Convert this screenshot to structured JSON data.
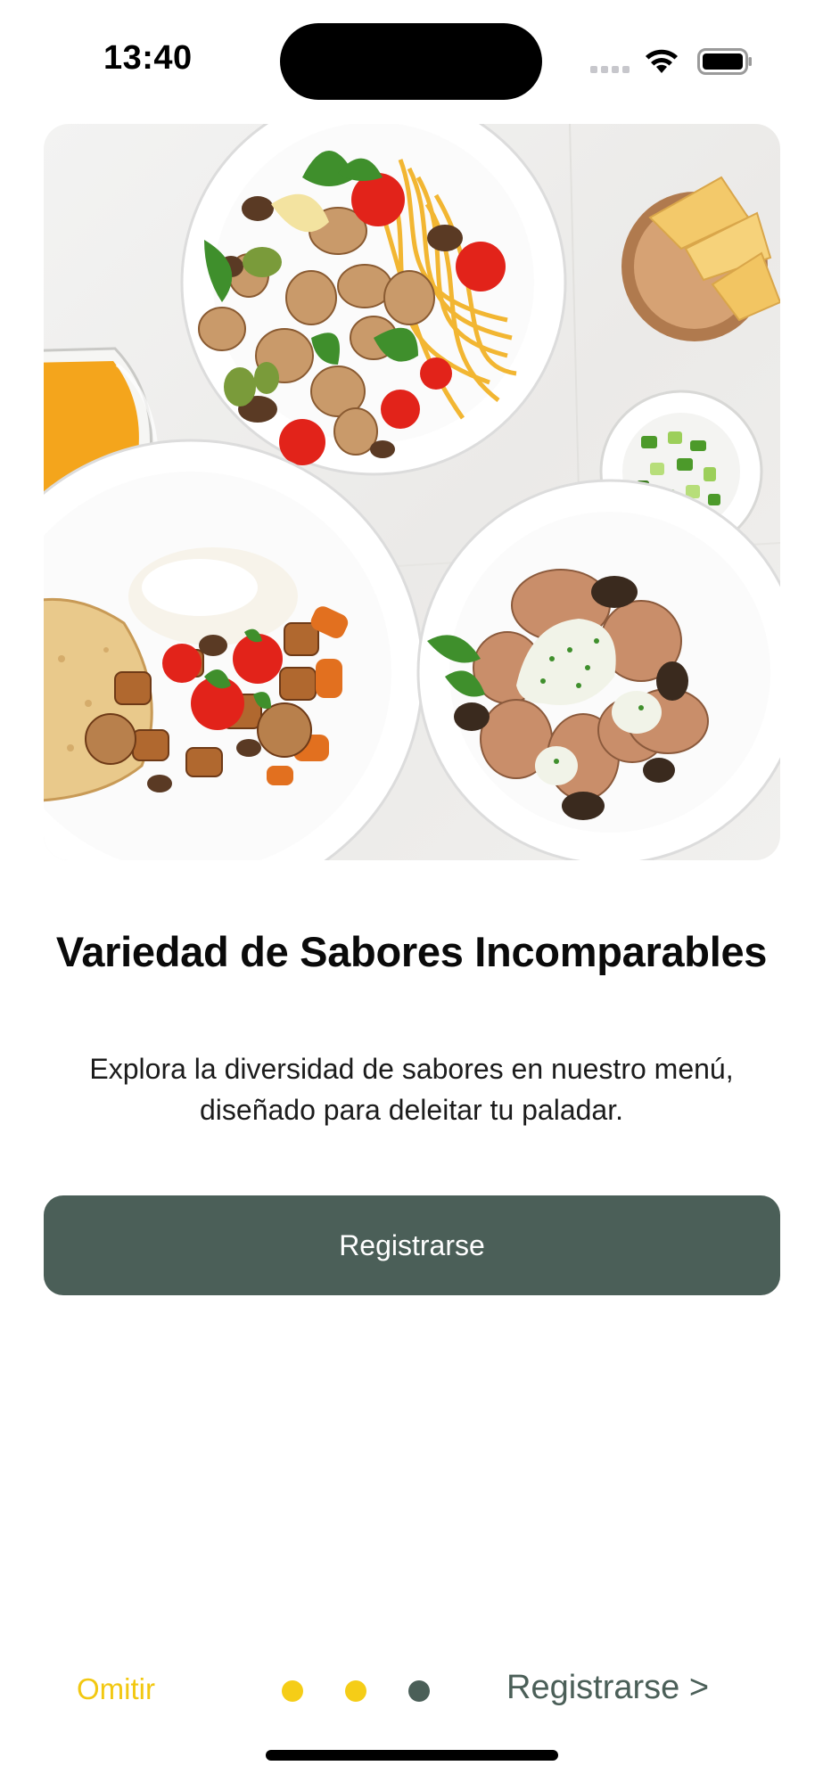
{
  "status_bar": {
    "time": "13:40"
  },
  "hero": {
    "icon": "food-photo",
    "colors": {
      "plate": "#ffffff",
      "tomato": "#e2231a",
      "pasta": "#f2b632",
      "herb": "#3f8f2c",
      "juice": "#f4a51c",
      "cheese": "#f3c96a"
    }
  },
  "content": {
    "title": "Variedad de Sabores Incomparables",
    "description_line1": "Explora la diversidad de sabores en nuestro menú,",
    "description_line2": "diseñado para deleitar tu paladar."
  },
  "primary_button": {
    "label": "Registrarse",
    "color": "#4b5f58"
  },
  "bottom_nav": {
    "skip_label": "Omitir",
    "next_label": "Registrarse >",
    "page_indicator": {
      "current": 3,
      "total": 3,
      "active_color": "#4b5f58",
      "inactive_color": "#f5cd17"
    }
  }
}
